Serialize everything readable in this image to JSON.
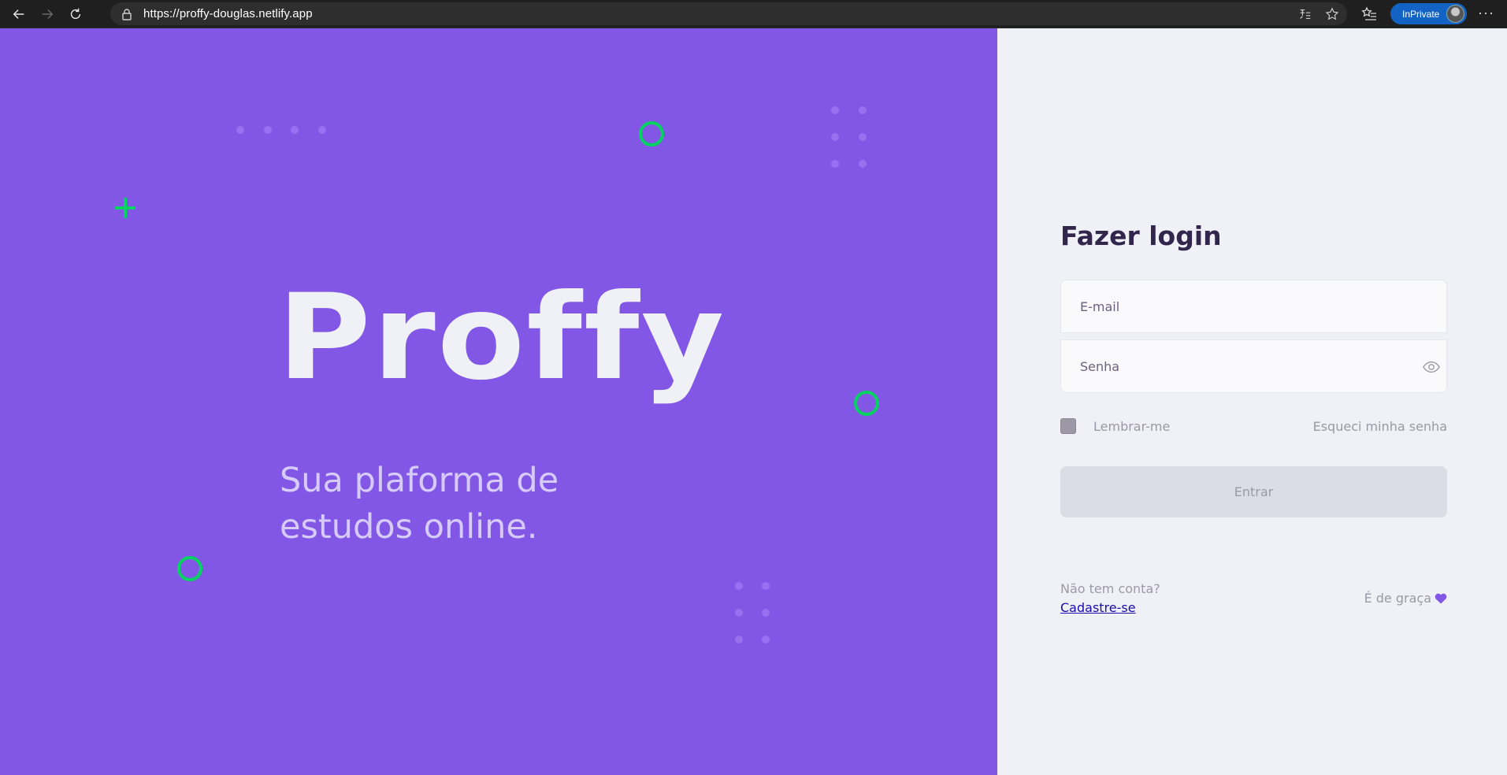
{
  "browser": {
    "url": "https://proffy-douglas.netlify.app",
    "inprivate_label": "InPrivate",
    "more_label": "···"
  },
  "hero": {
    "logo_text": "Proffy",
    "tagline_line1": "Sua plaforma de",
    "tagline_line2": "estudos online."
  },
  "login": {
    "title": "Fazer login",
    "email_placeholder": "E-mail",
    "email_value": "",
    "password_placeholder": "Senha",
    "password_value": "",
    "remember_label": "Lembrar-me",
    "remember_checked": false,
    "forgot_label": "Esqueci minha senha",
    "submit_label": "Entrar",
    "signup_question": "Não tem conta?",
    "signup_link": "Cadastre-se",
    "free_note": "É de graça"
  },
  "colors": {
    "primary": "#8257e5",
    "accent_green": "#04d361",
    "background": "#f0f0f7",
    "title": "#32264d",
    "muted": "#9c98a6"
  },
  "icons": [
    "back-arrow-icon",
    "forward-arrow-icon",
    "refresh-icon",
    "lock-icon",
    "read-aloud-icon",
    "favorite-star-icon",
    "favorites-list-icon",
    "eye-icon",
    "heart-icon"
  ]
}
